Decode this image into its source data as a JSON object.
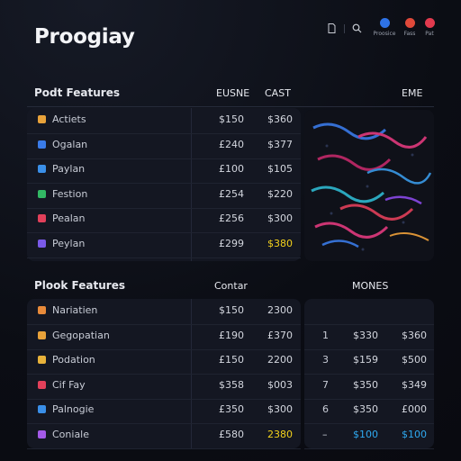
{
  "app": {
    "title": "Proogiay"
  },
  "header": {
    "icons": [
      "document-icon",
      "search-icon"
    ],
    "avatars": [
      {
        "label": "Proosice",
        "color": "#2e73e8"
      },
      {
        "label": "Fass",
        "color": "#e0493a"
      },
      {
        "label": "Pat",
        "color": "#e23a4e"
      }
    ]
  },
  "section1": {
    "title": "Podt Features",
    "col1": "EUSNE",
    "col2": "CAST",
    "side_title": "EME",
    "rows": [
      {
        "label": "Actiets",
        "icon_color": "#e8a23a",
        "v1": "$150",
        "v2": "$360"
      },
      {
        "label": "Ogalan",
        "icon_color": "#3a7be8",
        "v1": "£240",
        "v2": "$377"
      },
      {
        "label": "Paylan",
        "icon_color": "#3a8fe8",
        "v1": "£100",
        "v2": "$105"
      },
      {
        "label": "Festion",
        "icon_color": "#32b864",
        "v1": "£254",
        "v2": "$220"
      },
      {
        "label": "Pealan",
        "icon_color": "#e2405a",
        "v1": "£256",
        "v2": "$300"
      },
      {
        "label": "Peylan",
        "icon_color": "#7a5ae8",
        "v1": "£299",
        "v2": "$380",
        "v2_highlight": "yellow"
      }
    ]
  },
  "section2": {
    "title": "Plook Features",
    "col1": "Contar",
    "side_title": "MONES",
    "rows": [
      {
        "label": "Nariatien",
        "icon_color": "#e88a3a",
        "v1": "$150",
        "v2": "2300",
        "m0": "",
        "m1": "",
        "m2": ""
      },
      {
        "label": "Gegopatian",
        "icon_color": "#e8a23a",
        "v1": "£190",
        "v2": "£370",
        "m0": "1",
        "m1": "$330",
        "m2": "$360"
      },
      {
        "label": "Podation",
        "icon_color": "#e8b23a",
        "v1": "£150",
        "v2": "2200",
        "m0": "3",
        "m1": "$159",
        "m2": "$500"
      },
      {
        "label": "Cif Fay",
        "icon_color": "#e2405a",
        "v1": "$358",
        "v2": "$003",
        "m0": "7",
        "m1": "$350",
        "m2": "$349"
      },
      {
        "label": "Palnogie",
        "icon_color": "#3a8fe8",
        "v1": "£350",
        "v2": "$300",
        "m0": "6",
        "m1": "$350",
        "m2": "£000"
      },
      {
        "label": "Coniale",
        "icon_color": "#a45ae8",
        "v1": "£580",
        "v2": "2380",
        "v2_highlight": "yellow",
        "m0": "–",
        "m1": "$100",
        "m2": "$100",
        "m_highlight": "blue"
      }
    ]
  }
}
